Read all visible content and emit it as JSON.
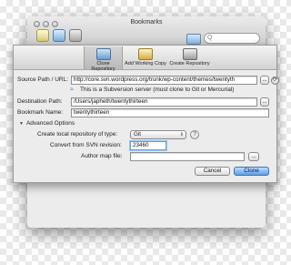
{
  "window": {
    "title": "Bookmarks",
    "search_placeholder": "Q"
  },
  "toolbar_tabs": [
    {
      "label": "Clone Repository",
      "active": true
    },
    {
      "label": "Add Working Copy",
      "active": false
    },
    {
      "label": "Create Repository",
      "active": false
    }
  ],
  "form": {
    "source_label": "Source Path / URL:",
    "source_value": "http://core.svn.wordpress.org/trunk/wp-content/themes/twentyth",
    "browse_label": "...",
    "svn_notice": "This is a Subversion server (must clone to Git or Mercurial)",
    "destination_label": "Destination Path:",
    "destination_value": "/Users/japheth/twentythirteen",
    "bookmark_label": "Bookmark Name:",
    "bookmark_value": "twentythirteen",
    "advanced_label": "Advanced Options",
    "repo_type_label": "Create local repository of type:",
    "repo_type_value": "Git",
    "help_label": "?",
    "revision_label": "Convert from SVN revision:",
    "revision_value": "23460",
    "author_map_label": "Author map file:",
    "author_map_value": "",
    "author_browse_label": "..."
  },
  "buttons": {
    "cancel": "Cancel",
    "clone": "Clone"
  },
  "colors": {
    "primary_button": "#5c9ee9",
    "dialog_bg": "#ececec"
  }
}
